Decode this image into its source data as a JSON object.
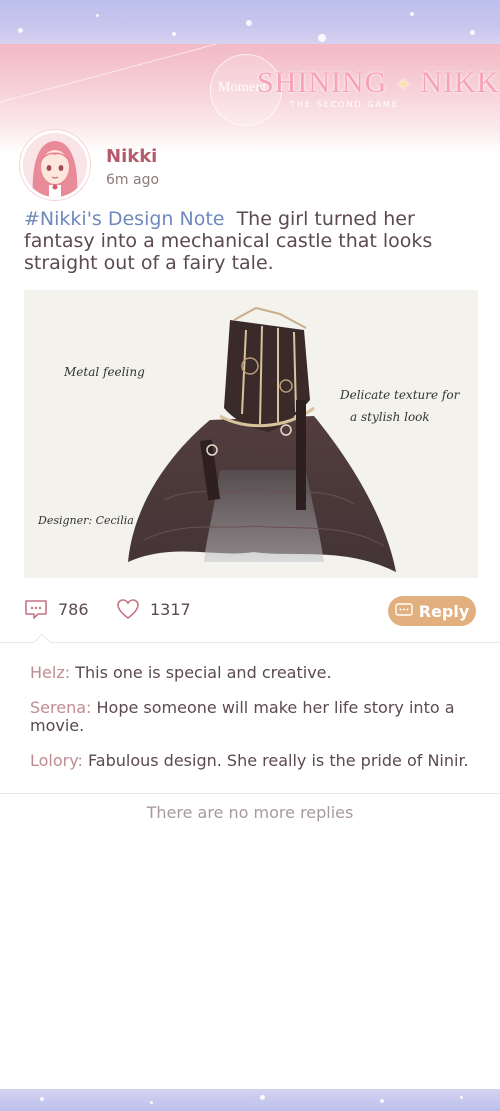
{
  "banner": {
    "logo_prefix": "Moment",
    "logo_title_1": "SHINING",
    "logo_title_2": "NIKKI",
    "logo_subtitle": "THE SECOND GAME"
  },
  "post": {
    "username": "Nikki",
    "time": "6m ago",
    "hashtag": "#Nikki's Design Note",
    "text": "The girl turned her fantasy into a mechanical castle that looks straight out of a fairy tale.",
    "image": {
      "annotations": [
        "Metal feeling",
        "Delicate texture for",
        "a stylish look",
        "Designer: Cecilia"
      ]
    }
  },
  "actions": {
    "comment_count": "786",
    "like_count": "1317",
    "reply_label": "Reply"
  },
  "comments": [
    {
      "author": "Helz",
      "sep": ":",
      "text": "This one is special and creative."
    },
    {
      "author": "Serena",
      "sep": ":",
      "text": "Hope someone will make her life story into a movie."
    },
    {
      "author": "Lolory",
      "sep": ":",
      "text": "Fabulous design. She really is the pride of Ninir."
    }
  ],
  "footer": {
    "no_more": "There are no more replies"
  },
  "colors": {
    "accent_pink": "#b55c6b",
    "hashtag_blue": "#6f89bd",
    "reply_button": "#e2b07f",
    "comment_author": "#bf8b93"
  }
}
